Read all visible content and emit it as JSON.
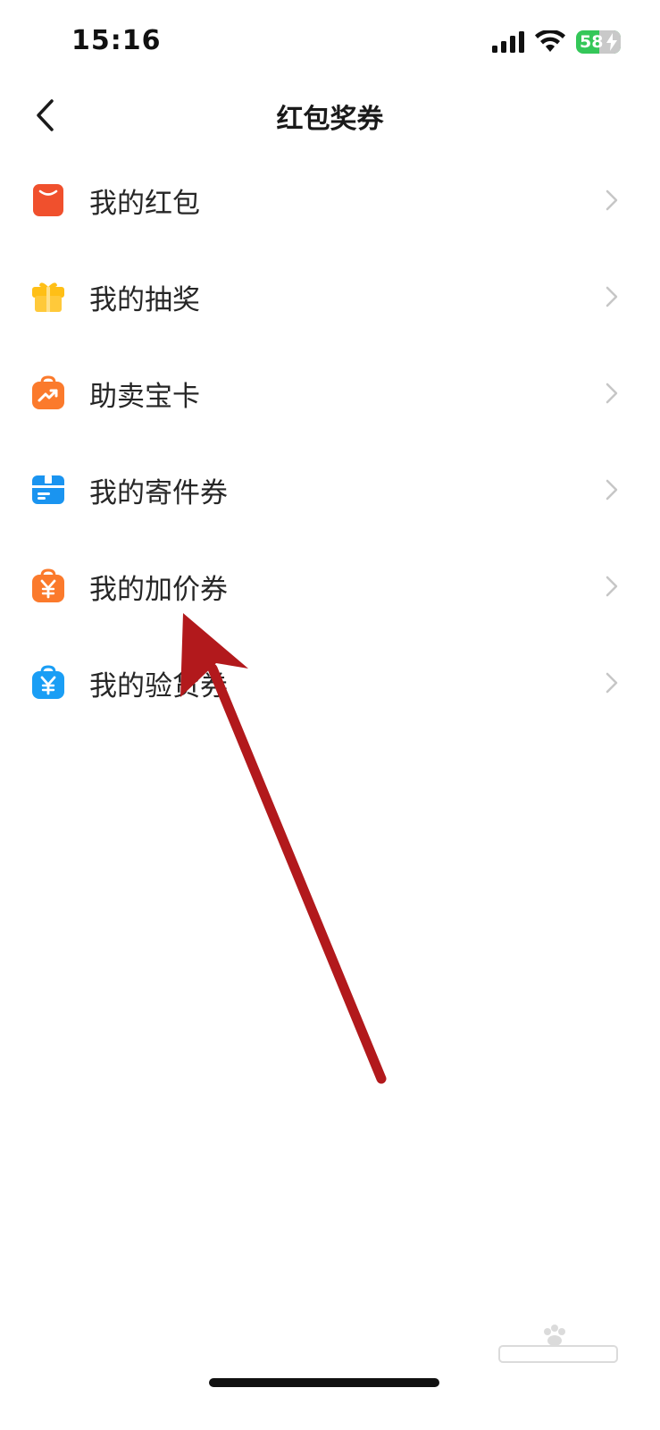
{
  "status_bar": {
    "time": "15:16",
    "battery_level": "58",
    "icons": [
      "cellular-signal-icon",
      "wifi-icon",
      "battery-charging-icon"
    ],
    "battery_color": "#34c759"
  },
  "header": {
    "title": "红包奖券",
    "back_icon": "chevron-left-icon"
  },
  "menu": {
    "items": [
      {
        "label": "我的红包",
        "icon": "red-envelope-icon",
        "color": "#f0502d"
      },
      {
        "label": "我的抽奖",
        "icon": "gift-box-icon",
        "color": "#ffbf16"
      },
      {
        "label": "助卖宝卡",
        "icon": "trend-bag-icon",
        "color": "#fb7a2c"
      },
      {
        "label": "我的寄件券",
        "icon": "parcel-icon",
        "color": "#1a94f0"
      },
      {
        "label": "我的加价券",
        "icon": "yuan-bag-icon",
        "color": "#fb7a2c"
      },
      {
        "label": "我的验货券",
        "icon": "yuan-bag-icon",
        "color": "#1a9ef5"
      }
    ],
    "chevron_icon": "chevron-right-icon"
  },
  "annotation": {
    "icon": "red-arrow-icon",
    "color": "#b2191c",
    "points_to": "我的加价券"
  },
  "watermark": {
    "icon": "baidu-jingyan-logo"
  }
}
